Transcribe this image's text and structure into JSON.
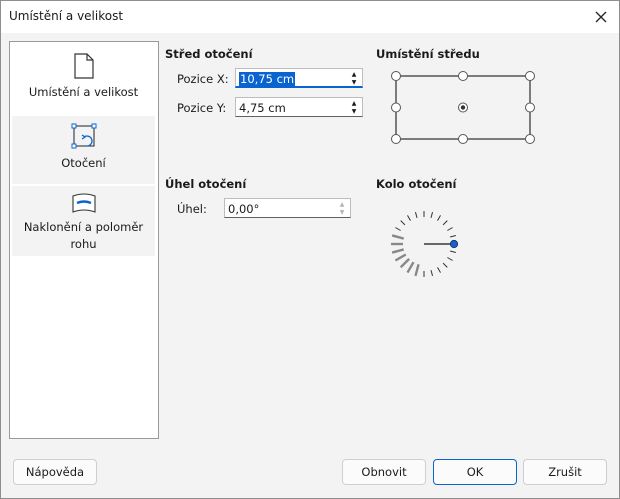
{
  "window": {
    "title": "Umístění a velikost"
  },
  "sidebar": {
    "items": [
      {
        "label": "Umístění a velikost",
        "icon": "page-icon"
      },
      {
        "label": "Otočení",
        "icon": "rotate-icon"
      },
      {
        "label": "Naklonění a poloměr rohu",
        "icon": "slant-icon"
      }
    ]
  },
  "pivot": {
    "title": "Střed otočení",
    "x_label": "Pozice X:",
    "x_value": "10,75 cm",
    "y_label": "Pozice Y:",
    "y_value": "4,75 cm"
  },
  "base_point": {
    "title": "Umístění středu",
    "selected": "center"
  },
  "angle": {
    "title": "Úhel otočení",
    "label": "Úhel:",
    "value": "0,00°"
  },
  "wheel": {
    "title": "Kolo otočení"
  },
  "buttons": {
    "help": "Nápověda",
    "reset": "Obnovit",
    "ok": "OK",
    "cancel": "Zrušit"
  },
  "colors": {
    "accent": "#0a64d0"
  }
}
